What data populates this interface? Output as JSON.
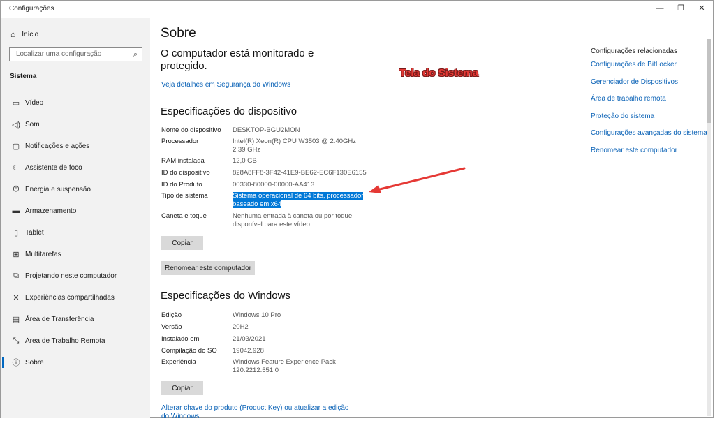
{
  "window": {
    "title": "Configurações",
    "controls": {
      "minimize": "—",
      "restore": "❐",
      "close": "✕"
    }
  },
  "sidebar": {
    "home": {
      "icon": "home-icon",
      "label": "Início"
    },
    "search_placeholder": "Localizar uma configuração",
    "section": "Sistema",
    "items": [
      {
        "icon": "display-icon",
        "label": "Vídeo"
      },
      {
        "icon": "speaker-icon",
        "label": "Som"
      },
      {
        "icon": "notification-icon",
        "label": "Notificações e ações"
      },
      {
        "icon": "moon-icon",
        "label": "Assistente de foco"
      },
      {
        "icon": "power-icon",
        "label": "Energia e suspensão"
      },
      {
        "icon": "storage-icon",
        "label": "Armazenamento"
      },
      {
        "icon": "tablet-icon",
        "label": "Tablet"
      },
      {
        "icon": "multitask-icon",
        "label": "Multitarefas"
      },
      {
        "icon": "projector-icon",
        "label": "Projetando neste computador"
      },
      {
        "icon": "shared-icon",
        "label": "Experiências compartilhadas"
      },
      {
        "icon": "clipboard-icon",
        "label": "Área de Transferência"
      },
      {
        "icon": "remote-icon",
        "label": "Área de Trabalho Remota"
      },
      {
        "icon": "info-icon",
        "label": "Sobre"
      }
    ]
  },
  "main": {
    "title": "Sobre",
    "protected_text": "O computador está monitorado e protegido.",
    "security_link": "Veja detalhes em Segurança do Windows",
    "device_specs": {
      "heading": "Especificações do dispositivo",
      "rows": [
        {
          "label": "Nome do dispositivo",
          "value": "DESKTOP-BGU2MON"
        },
        {
          "label": "Processador",
          "value": "Intel(R) Xeon(R) CPU         W3503  @ 2.40GHz\n2.39 GHz"
        },
        {
          "label": "RAM instalada",
          "value": "12,0 GB"
        },
        {
          "label": "ID do dispositivo",
          "value": "828A8FF8-3F42-41E9-BE62-EC6F130E6155"
        },
        {
          "label": "ID do Produto",
          "value": "00330-80000-00000-AA413"
        },
        {
          "label": "Tipo de sistema",
          "value": "Sistema operacional de 64 bits, processador baseado em x64"
        },
        {
          "label": "Caneta e toque",
          "value": "Nenhuma entrada à caneta ou por toque\ndisponível para este vídeo"
        }
      ],
      "copy_button": "Copiar",
      "rename_button": "Renomear este computador"
    },
    "windows_specs": {
      "heading": "Especificações do Windows",
      "rows": [
        {
          "label": "Edição",
          "value": "Windows 10 Pro"
        },
        {
          "label": "Versão",
          "value": "20H2"
        },
        {
          "label": "Instalado em",
          "value": "21/03/2021"
        },
        {
          "label": "Compilação do SO",
          "value": "19042.928"
        },
        {
          "label": "Experiência",
          "value": "Windows Feature Experience Pack\n120.2212.551.0"
        }
      ],
      "copy_button": "Copiar"
    },
    "product_key_link": "Alterar chave do produto (Product Key) ou atualizar a edição do Windows"
  },
  "related": {
    "title": "Configurações relacionadas",
    "links": [
      "Configurações de BitLocker",
      "Gerenciador de Dispositivos",
      "Área de trabalho remota",
      "Proteção do sistema",
      "Configurações avançadas do sistema",
      "Renomear este computador"
    ]
  },
  "annotation": {
    "text": "Tela do Sistema",
    "color": "#e53935"
  }
}
